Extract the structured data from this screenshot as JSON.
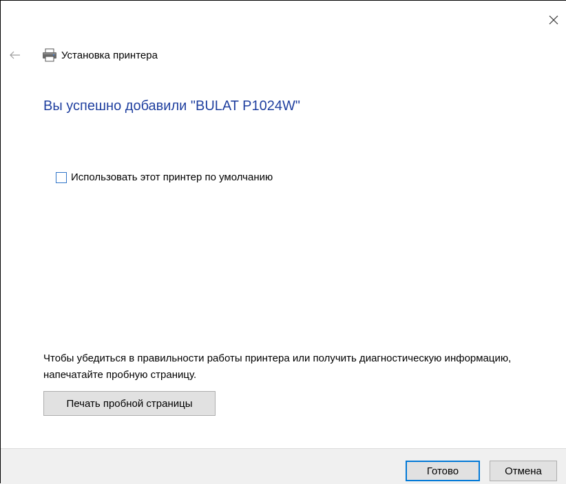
{
  "window": {
    "title": "Установка принтера"
  },
  "main": {
    "heading": "Вы успешно добавили \"BULAT P1024W\"",
    "default_checkbox": {
      "label": "Использовать этот принтер по умолчанию",
      "checked": false
    },
    "info_text": "Чтобы убедиться в правильности работы принтера или получить диагностическую информацию, напечатайте пробную страницу.",
    "test_page_button": "Печать пробной страницы"
  },
  "footer": {
    "ok_button": "Готово",
    "cancel_button": "Отмена"
  },
  "icons": {
    "close": "close-icon",
    "back": "back-arrow-icon",
    "printer": "printer-icon"
  },
  "colors": {
    "heading": "#1f3f9f",
    "checkbox_border": "#2f74c8",
    "default_button_border": "#0078d7",
    "footer_background": "#f0f0f0",
    "button_background": "#e1e1e1"
  }
}
